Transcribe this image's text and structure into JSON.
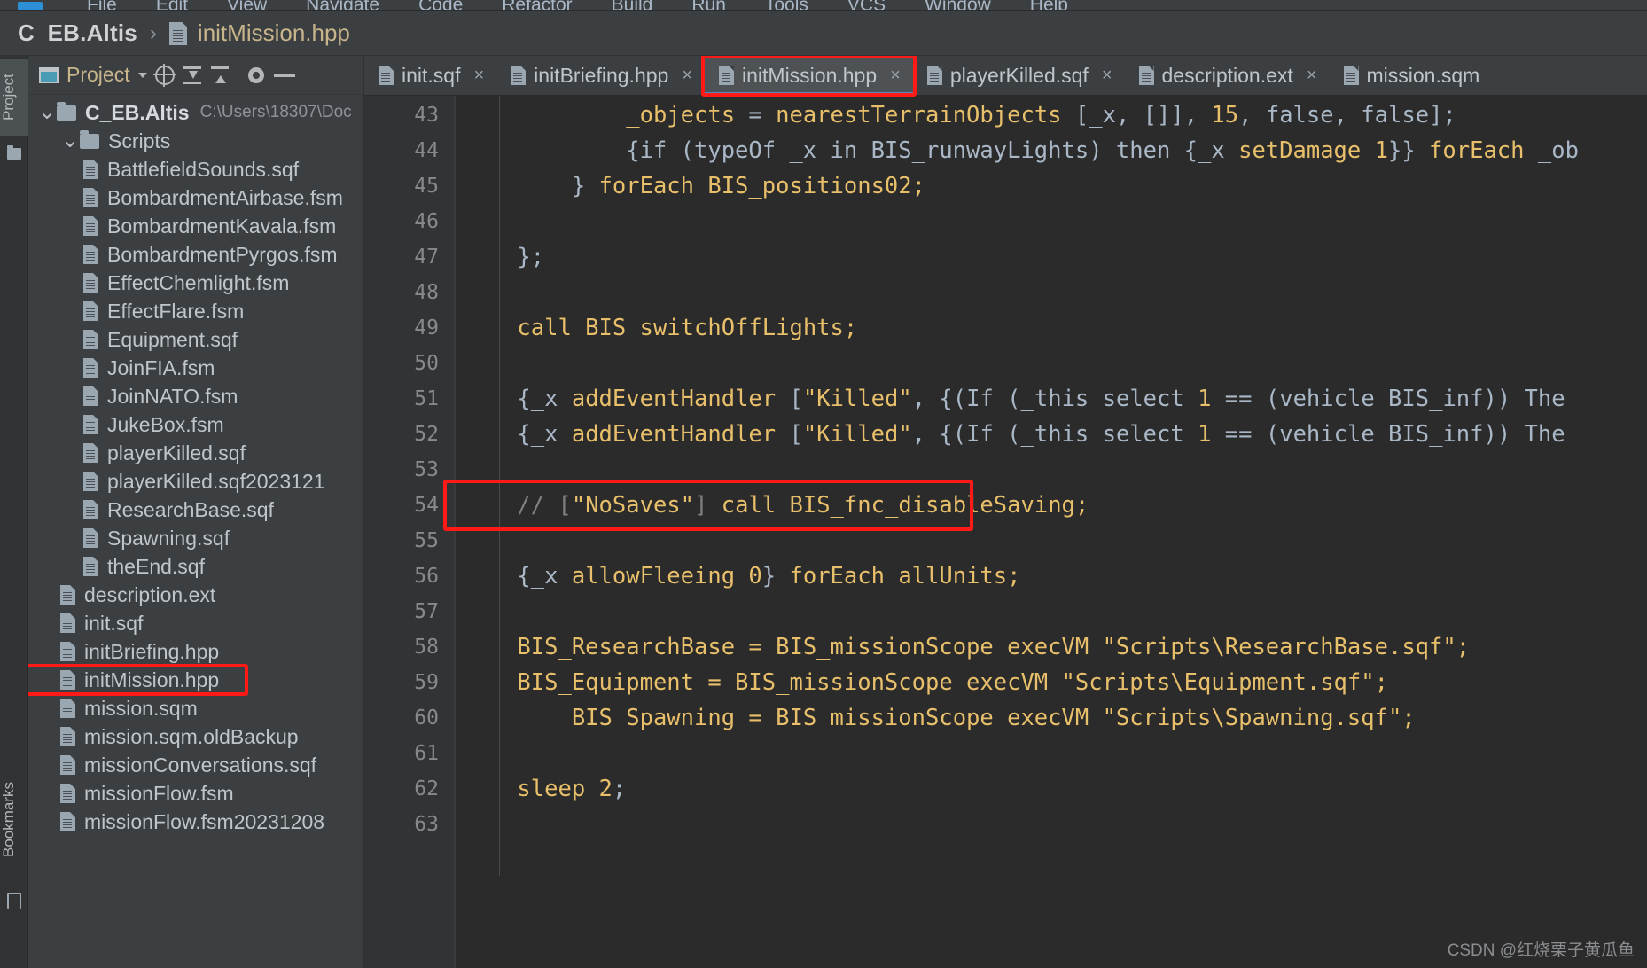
{
  "menubar": {
    "items": [
      "File",
      "Edit",
      "View",
      "Navigate",
      "Code",
      "Refactor",
      "Build",
      "Run",
      "Tools",
      "VCS",
      "Window",
      "Help"
    ]
  },
  "breadcrumb": {
    "root": "C_EB.Altis",
    "separator": "›",
    "file": "initMission.hpp",
    "file_icon": "file-icon"
  },
  "left_strip": {
    "project_tab": "Project",
    "bookmarks_tab": "Bookmarks",
    "folder_icon": "folder-icon",
    "bookmark_icon": "bookmark-icon"
  },
  "project_panel": {
    "title": "Project",
    "window_icon": "project-window-icon",
    "toolbar_icons": [
      "chevron-down-icon",
      "locate-target-icon",
      "expand-all-icon",
      "collapse-all-icon",
      "gear-icon",
      "minimize-icon"
    ],
    "tree": [
      {
        "label": "C_EB.Altis",
        "path": "C:\\Users\\18307\\Doc",
        "depth": 0,
        "type": "folder",
        "expanded": true,
        "bold": true
      },
      {
        "label": "Scripts",
        "path": "",
        "depth": 1,
        "type": "folder",
        "expanded": true,
        "bold": false
      },
      {
        "label": "BattlefieldSounds.sqf",
        "path": "",
        "depth": 2,
        "type": "file"
      },
      {
        "label": "BombardmentAirbase.fsm",
        "path": "",
        "depth": 2,
        "type": "file"
      },
      {
        "label": "BombardmentKavala.fsm",
        "path": "",
        "depth": 2,
        "type": "file"
      },
      {
        "label": "BombardmentPyrgos.fsm",
        "path": "",
        "depth": 2,
        "type": "file"
      },
      {
        "label": "EffectChemlight.fsm",
        "path": "",
        "depth": 2,
        "type": "file"
      },
      {
        "label": "EffectFlare.fsm",
        "path": "",
        "depth": 2,
        "type": "file"
      },
      {
        "label": "Equipment.sqf",
        "path": "",
        "depth": 2,
        "type": "file"
      },
      {
        "label": "JoinFIA.fsm",
        "path": "",
        "depth": 2,
        "type": "file"
      },
      {
        "label": "JoinNATO.fsm",
        "path": "",
        "depth": 2,
        "type": "file"
      },
      {
        "label": "JukeBox.fsm",
        "path": "",
        "depth": 2,
        "type": "file"
      },
      {
        "label": "playerKilled.sqf",
        "path": "",
        "depth": 2,
        "type": "file"
      },
      {
        "label": "playerKilled.sqf2023121",
        "path": "",
        "depth": 2,
        "type": "file"
      },
      {
        "label": "ResearchBase.sqf",
        "path": "",
        "depth": 2,
        "type": "file"
      },
      {
        "label": "Spawning.sqf",
        "path": "",
        "depth": 2,
        "type": "file"
      },
      {
        "label": "theEnd.sqf",
        "path": "",
        "depth": 2,
        "type": "file"
      },
      {
        "label": "description.ext",
        "path": "",
        "depth": 1,
        "type": "file"
      },
      {
        "label": "init.sqf",
        "path": "",
        "depth": 1,
        "type": "file"
      },
      {
        "label": "initBriefing.hpp",
        "path": "",
        "depth": 1,
        "type": "file"
      },
      {
        "label": "initMission.hpp",
        "path": "",
        "depth": 1,
        "type": "file",
        "highlighted": true
      },
      {
        "label": "mission.sqm",
        "path": "",
        "depth": 1,
        "type": "file"
      },
      {
        "label": "mission.sqm.oldBackup",
        "path": "",
        "depth": 1,
        "type": "file"
      },
      {
        "label": "missionConversations.sqf",
        "path": "",
        "depth": 1,
        "type": "file"
      },
      {
        "label": "missionFlow.fsm",
        "path": "",
        "depth": 1,
        "type": "file"
      },
      {
        "label": "missionFlow.fsm20231208",
        "path": "",
        "depth": 1,
        "type": "file"
      }
    ]
  },
  "editor": {
    "tabs": [
      {
        "label": "init.sqf",
        "active": false,
        "closable": true
      },
      {
        "label": "initBriefing.hpp",
        "active": false,
        "closable": true
      },
      {
        "label": "initMission.hpp",
        "active": true,
        "closable": true,
        "highlighted": true
      },
      {
        "label": "playerKilled.sqf",
        "active": false,
        "closable": true
      },
      {
        "label": "description.ext",
        "active": false,
        "closable": true
      },
      {
        "label": "mission.sqm",
        "active": false,
        "closable": false
      }
    ],
    "first_line_number": 43,
    "lines": [
      {
        "n": 43,
        "tokens": [
          {
            "t": "            ",
            "c": "plain"
          },
          {
            "t": "_objects",
            "c": "fn"
          },
          {
            "t": " = ",
            "c": "plain"
          },
          {
            "t": "nearestTerrainObjects",
            "c": "fn"
          },
          {
            "t": " [_x, []], ",
            "c": "plain"
          },
          {
            "t": "15",
            "c": "num"
          },
          {
            "t": ", false, false];",
            "c": "plain"
          }
        ]
      },
      {
        "n": 44,
        "tokens": [
          {
            "t": "            {if (typeOf _x in BIS_runwayLights) then {_x ",
            "c": "plain"
          },
          {
            "t": "setDamage",
            "c": "fn"
          },
          {
            "t": " ",
            "c": "plain"
          },
          {
            "t": "1",
            "c": "num"
          },
          {
            "t": "}} ",
            "c": "plain"
          },
          {
            "t": "forEach",
            "c": "fn"
          },
          {
            "t": " _ob",
            "c": "plain"
          }
        ]
      },
      {
        "n": 45,
        "tokens": [
          {
            "t": "        } ",
            "c": "plain"
          },
          {
            "t": "forEach",
            "c": "fn"
          },
          {
            "t": " BIS_positions02;",
            "c": "fn"
          }
        ]
      },
      {
        "n": 46,
        "tokens": []
      },
      {
        "n": 47,
        "tokens": [
          {
            "t": "    };",
            "c": "plain"
          }
        ]
      },
      {
        "n": 48,
        "tokens": []
      },
      {
        "n": 49,
        "tokens": [
          {
            "t": "    ",
            "c": "plain"
          },
          {
            "t": "call BIS_switchOffLights;",
            "c": "fn"
          }
        ]
      },
      {
        "n": 50,
        "tokens": []
      },
      {
        "n": 51,
        "tokens": [
          {
            "t": "    ",
            "c": "plain"
          },
          {
            "t": "{_x ",
            "c": "plain"
          },
          {
            "t": "addEventHandler",
            "c": "fn"
          },
          {
            "t": " [",
            "c": "plain"
          },
          {
            "t": "\"Killed\"",
            "c": "str"
          },
          {
            "t": ", {(If (_this select ",
            "c": "plain"
          },
          {
            "t": "1",
            "c": "num"
          },
          {
            "t": " == (vehicle BIS_inf)) The",
            "c": "plain"
          }
        ]
      },
      {
        "n": 52,
        "tokens": [
          {
            "t": "    ",
            "c": "plain"
          },
          {
            "t": "{_x ",
            "c": "plain"
          },
          {
            "t": "addEventHandler",
            "c": "fn"
          },
          {
            "t": " [",
            "c": "plain"
          },
          {
            "t": "\"Killed\"",
            "c": "str"
          },
          {
            "t": ", {(If (_this select ",
            "c": "plain"
          },
          {
            "t": "1",
            "c": "num"
          },
          {
            "t": " == (vehicle BIS_inf)) The",
            "c": "plain"
          }
        ]
      },
      {
        "n": 53,
        "tokens": []
      },
      {
        "n": 54,
        "highlighted": true,
        "tokens": [
          {
            "t": "    ",
            "c": "plain"
          },
          {
            "t": "// [",
            "c": "cmt"
          },
          {
            "t": "\"NoSaves\"",
            "c": "str"
          },
          {
            "t": "] ",
            "c": "cmt"
          },
          {
            "t": "call BIS_fnc_disableSaving;",
            "c": "fn"
          }
        ]
      },
      {
        "n": 55,
        "tokens": []
      },
      {
        "n": 56,
        "tokens": [
          {
            "t": "    {_x ",
            "c": "plain"
          },
          {
            "t": "allowFleeing",
            "c": "fn"
          },
          {
            "t": " ",
            "c": "plain"
          },
          {
            "t": "0",
            "c": "num"
          },
          {
            "t": "} ",
            "c": "plain"
          },
          {
            "t": "forEach",
            "c": "fn"
          },
          {
            "t": " allUnits;",
            "c": "fn"
          }
        ]
      },
      {
        "n": 57,
        "tokens": []
      },
      {
        "n": 58,
        "tokens": [
          {
            "t": "    ",
            "c": "plain"
          },
          {
            "t": "BIS_ResearchBase = BIS_missionScope execVM ",
            "c": "fn"
          },
          {
            "t": "\"Scripts\\ResearchBase.sqf\"",
            "c": "str"
          },
          {
            "t": ";",
            "c": "fn"
          }
        ]
      },
      {
        "n": 59,
        "tokens": [
          {
            "t": "    ",
            "c": "plain"
          },
          {
            "t": "BIS_Equipment = BIS_missionScope execVM ",
            "c": "fn"
          },
          {
            "t": "\"Scripts\\Equipment.sqf\"",
            "c": "str"
          },
          {
            "t": ";",
            "c": "fn"
          }
        ]
      },
      {
        "n": 60,
        "tokens": [
          {
            "t": "        ",
            "c": "plain"
          },
          {
            "t": "BIS_Spawning = BIS_missionScope execVM ",
            "c": "fn"
          },
          {
            "t": "\"Scripts\\Spawning.sqf\"",
            "c": "str"
          },
          {
            "t": ";",
            "c": "fn"
          }
        ]
      },
      {
        "n": 61,
        "tokens": []
      },
      {
        "n": 62,
        "tokens": [
          {
            "t": "    ",
            "c": "plain"
          },
          {
            "t": "sleep",
            "c": "fn"
          },
          {
            "t": " ",
            "c": "plain"
          },
          {
            "t": "2",
            "c": "num"
          },
          {
            "t": ";",
            "c": "plain"
          }
        ]
      },
      {
        "n": 63,
        "tokens": []
      }
    ]
  },
  "watermark": "CSDN @红烧栗子黄瓜鱼",
  "colors": {
    "annotation_red": "#ff1a17",
    "editor_bg": "#2b2b2b",
    "panel_bg": "#3c3f41",
    "gutter_bg": "#313335",
    "function_yellow": "#e8bf6a",
    "identifier_grey": "#a9b7c6",
    "comment_grey": "#808080",
    "tab_active_bg": "#4e5254",
    "tab_underline": "#4a88c7"
  }
}
